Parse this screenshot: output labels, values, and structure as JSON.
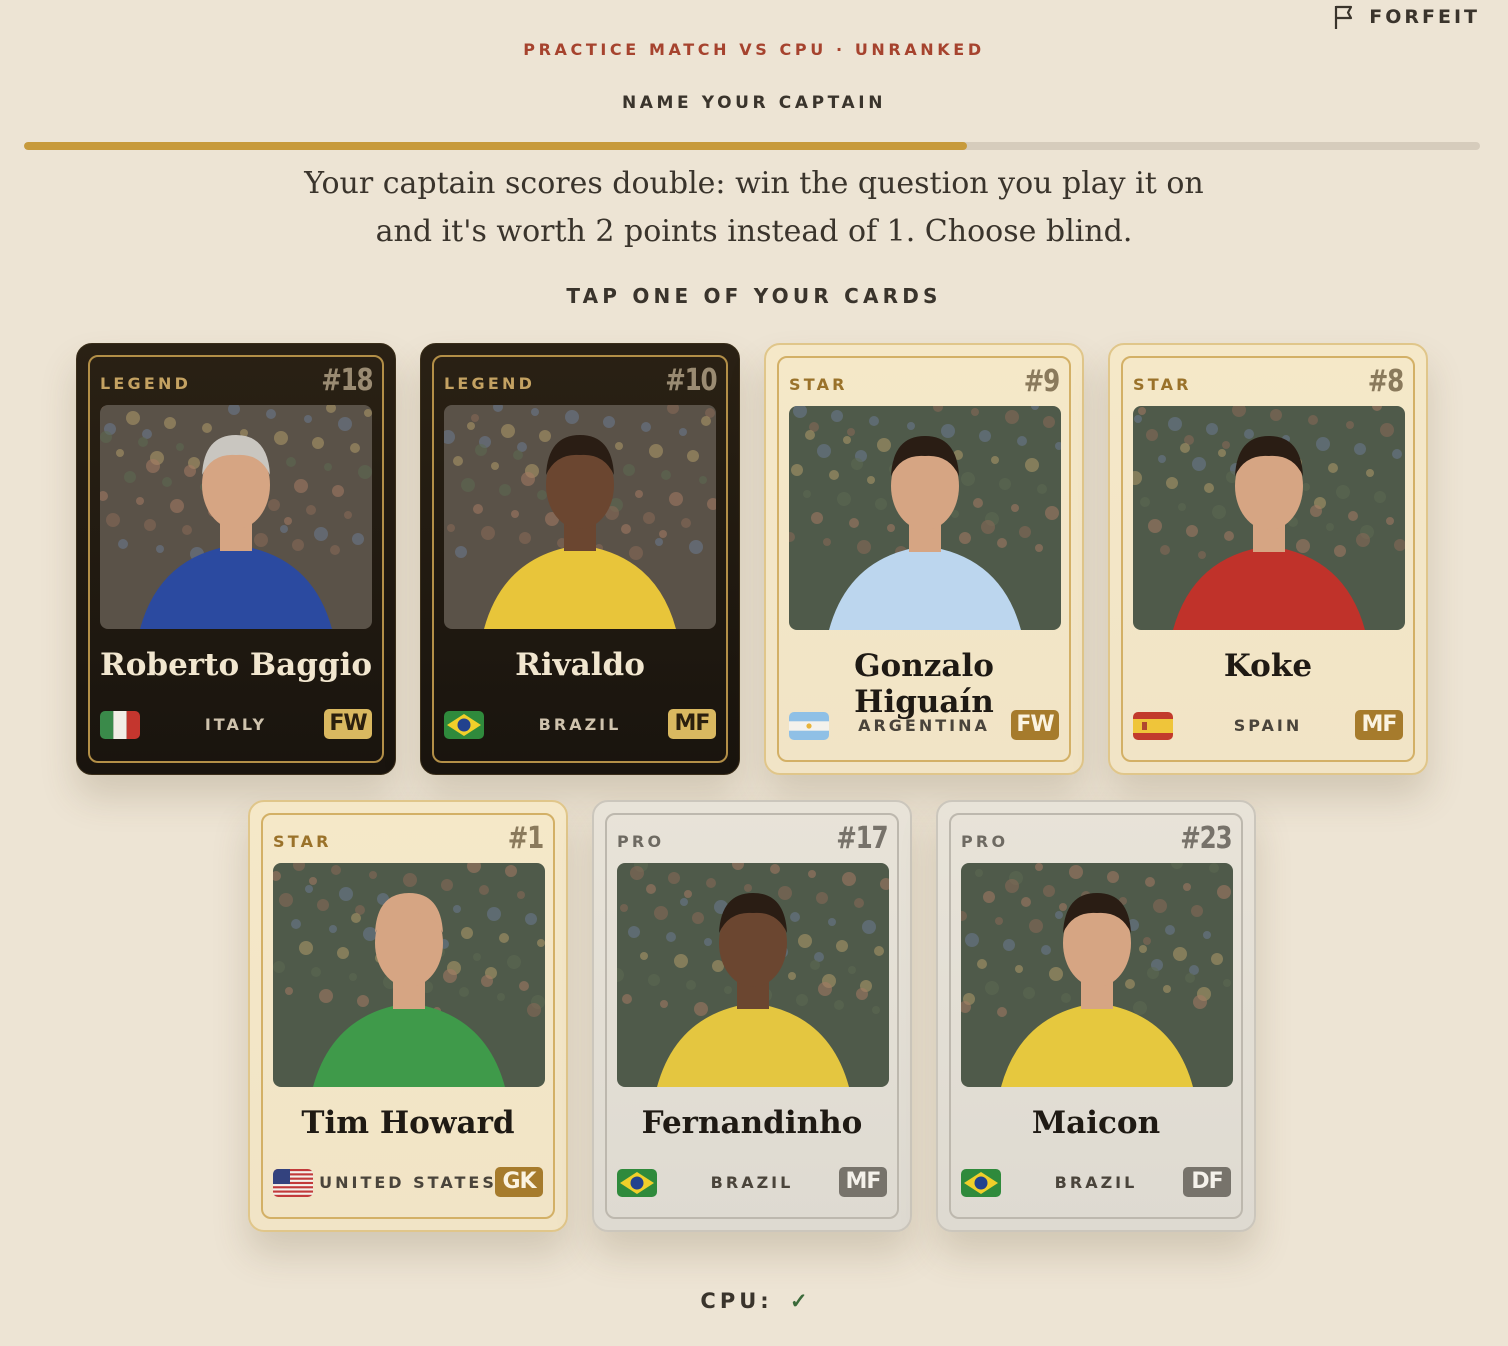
{
  "header": {
    "forfeit_label": "FORFEIT",
    "mode_label": "PRACTICE MATCH VS CPU · UNRANKED",
    "phase_title": "NAME YOUR CAPTAIN",
    "progress_fraction": 0.648
  },
  "instructions": {
    "line1": "Your captain scores double: win the question you play it on",
    "line2": "and it's worth 2 points instead of 1. Choose blind."
  },
  "tap_label": "TAP ONE OF YOUR CARDS",
  "cards": [
    {
      "tier": "LEGEND",
      "number": "#18",
      "name": "Roberto Baggio",
      "country": "ITALY",
      "position": "FW",
      "flag": "italy-flag",
      "kit": "#2b4aa0"
    },
    {
      "tier": "LEGEND",
      "number": "#10",
      "name": "Rivaldo",
      "country": "BRAZIL",
      "position": "MF",
      "flag": "brazil-flag",
      "kit": "#e8c53a"
    },
    {
      "tier": "STAR",
      "number": "#9",
      "name": "Gonzalo Higuaín",
      "country": "ARGENTINA",
      "position": "FW",
      "flag": "argentina-flag",
      "kit": "#bcd6ee"
    },
    {
      "tier": "STAR",
      "number": "#8",
      "name": "Koke",
      "country": "SPAIN",
      "position": "MF",
      "flag": "spain-flag",
      "kit": "#c0322a"
    },
    {
      "tier": "STAR",
      "number": "#1",
      "name": "Tim Howard",
      "country": "UNITED STATES",
      "position": "GK",
      "flag": "usa-flag",
      "kit": "#3f9a4a"
    },
    {
      "tier": "PRO",
      "number": "#17",
      "name": "Fernandinho",
      "country": "BRAZIL",
      "position": "MF",
      "flag": "brazil-flag",
      "kit": "#e4c640"
    },
    {
      "tier": "PRO",
      "number": "#23",
      "name": "Maicon",
      "country": "BRAZIL",
      "position": "DF",
      "flag": "brazil-flag",
      "kit": "#e6c83e"
    }
  ],
  "cpu": {
    "label": "CPU:",
    "status": "✓"
  }
}
